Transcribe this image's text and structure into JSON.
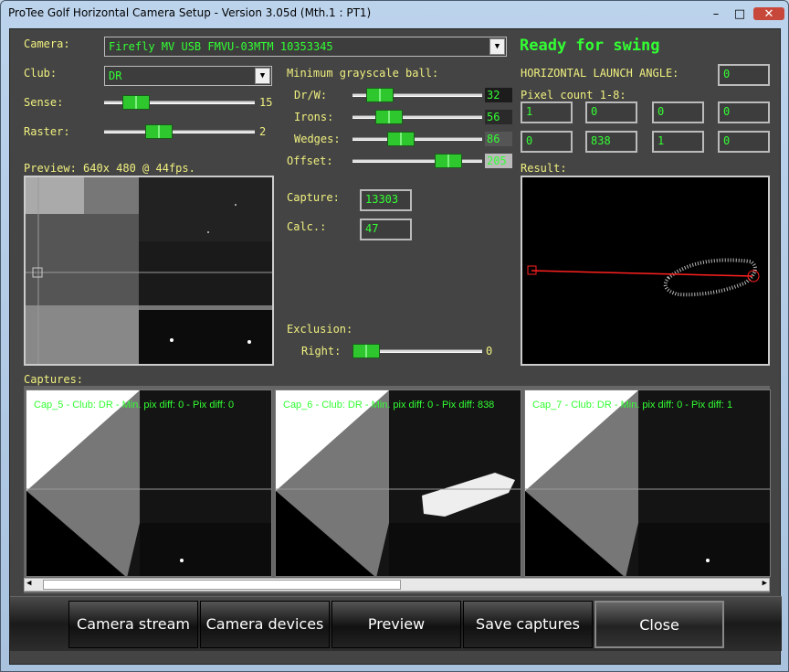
{
  "window": {
    "title": "ProTee Golf Horizontal Camera Setup - Version 3.05d (Mth.1 : PT1)"
  },
  "camera": {
    "label": "Camera:",
    "value": "Firefly MV USB FMVU-03MTM 10353345"
  },
  "status": "Ready for swing",
  "club": {
    "label": "Club:",
    "value": "DR"
  },
  "sense": {
    "label": "Sense:",
    "value": "15",
    "level": 0.15
  },
  "raster": {
    "label": "Raster:",
    "value": "2",
    "level": 0.33
  },
  "min_gray": {
    "label": "Minimum grayscale ball:",
    "drw": {
      "label": "Dr/W:",
      "value": "32",
      "level": 0.13
    },
    "irons": {
      "label": "Irons:",
      "value": "56",
      "level": 0.22
    },
    "wedges": {
      "label": "Wedges:",
      "value": "86",
      "level": 0.34
    },
    "offset": {
      "label": "Offset:",
      "value": "205",
      "level": 0.8
    }
  },
  "launch": {
    "label": "HORIZONTAL LAUNCH ANGLE:",
    "value": "0"
  },
  "pixel_count": {
    "label": "Pixel count 1-8:",
    "values": [
      "1",
      "0",
      "0",
      "0",
      "0",
      "838",
      "1",
      "0"
    ]
  },
  "preview": {
    "label": "Preview: 640x 480 @ 44fps."
  },
  "capture": {
    "label": "Capture:",
    "value": "13303"
  },
  "calc": {
    "label": "Calc.:",
    "value": "47"
  },
  "exclusion": {
    "label": "Exclusion:",
    "right_label": "Right:",
    "value": "0",
    "level": 0.0
  },
  "result": {
    "label": "Result:"
  },
  "captures": {
    "label": "Captures:",
    "items": [
      "Cap_5 - Club: DR - Min. pix diff: 0 - Pix diff: 0",
      "Cap_6 - Club: DR - Min. pix diff: 0 - Pix diff: 838",
      "Cap_7 - Club: DR - Min. pix diff: 0 - Pix diff: 1"
    ]
  },
  "buttons": {
    "camera_stream": "Camera stream",
    "camera_devices": "Camera devices",
    "preview": "Preview",
    "save_captures": "Save captures",
    "close": "Close"
  },
  "icons": {
    "minimize": "minimize-icon",
    "maximize": "maximize-icon",
    "close": "close-icon"
  },
  "colors": {
    "label": "#f0f080",
    "value_green": "#33ff33",
    "slider": "#2ec82e",
    "trajectory": "#ff2020"
  }
}
